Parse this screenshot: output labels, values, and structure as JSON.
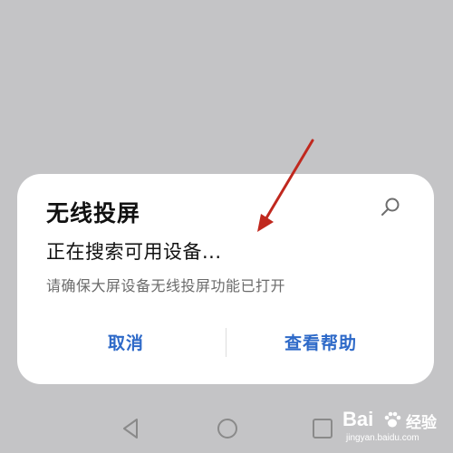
{
  "dialog": {
    "title": "无线投屏",
    "status": "正在搜索可用设备...",
    "hint": "请确保大屏设备无线投屏功能已打开",
    "cancel_label": "取消",
    "help_label": "查看帮助",
    "accent_color": "#2d69c8"
  },
  "annotation": {
    "arrow_color": "#c0281e"
  },
  "icons": {
    "spinner": "searching-spinner-icon",
    "nav_back": "triangle-back-icon",
    "nav_home": "circle-home-icon",
    "nav_recent": "square-recent-icon"
  },
  "watermark": {
    "brand": "Bai",
    "suffix": "经验",
    "url": "jingyan.baidu.com"
  }
}
